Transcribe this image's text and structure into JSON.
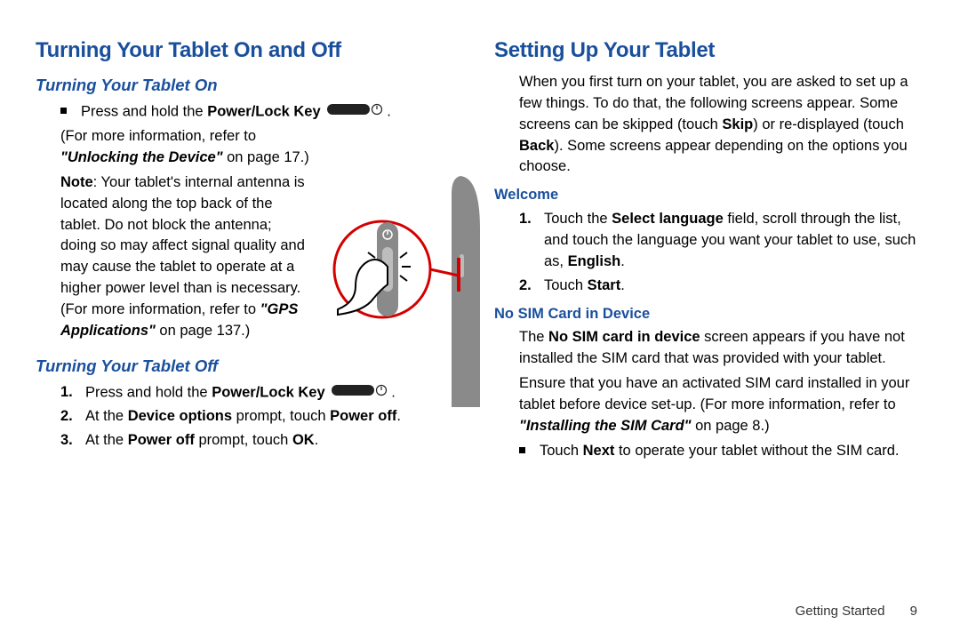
{
  "left": {
    "h1": "Turning Your Tablet On and Off",
    "sub_on": "Turning Your Tablet On",
    "on_bullet_a": "Press and hold the ",
    "on_bullet_b": "Power/Lock Key",
    "more1_a": "(For more information, refer to ",
    "more1_b": "\"Unlocking the Device\"",
    "more1_c": " on page 17.)",
    "note_a": "Note",
    "note_b": ": Your tablet's internal antenna is located along the top back of the tablet. Do not block the antenna; doing so may affect signal quality and may cause the tablet to operate at a higher power level than is necessary. (For more information, refer to ",
    "note_c": "\"GPS Applications\"",
    "note_d": " on page 137.)",
    "sub_off": "Turning Your Tablet Off",
    "off_1a": "Press and hold the ",
    "off_1b": "Power/Lock Key",
    "off_2a": "At the ",
    "off_2b": "Device options",
    "off_2c": " prompt, touch ",
    "off_2d": "Power off",
    "off_3a": "At the ",
    "off_3b": "Power off",
    "off_3c": " prompt, touch ",
    "off_3d": "OK",
    "n1": "1.",
    "n2": "2.",
    "n3": "3."
  },
  "right": {
    "h1": "Setting Up Your Tablet",
    "intro_a": "When you first turn on your tablet, you are asked to set up a few things. To do that, the following screens appear. Some screens can be skipped (touch ",
    "intro_b": "Skip",
    "intro_c": ") or re-displayed (touch ",
    "intro_d": "Back",
    "intro_e": "). Some screens appear depending on the options you choose.",
    "welcome_h": "Welcome",
    "w1a": "Touch the ",
    "w1b": "Select language",
    "w1c": " field, scroll through the list, and touch the language you want your tablet to use, such as, ",
    "w1d": "English",
    "w2a": "Touch ",
    "w2b": "Start",
    "nosim_h": "No SIM Card in Device",
    "ns1a": "The ",
    "ns1b": "No SIM card in device",
    "ns1c": " screen appears if you have not installed the SIM card that was provided with your tablet.",
    "ns2a": "Ensure that you have an activated SIM card installed in your tablet before device set-up. (For more information, refer to ",
    "ns2b": "\"Installing the SIM Card\"",
    "ns2c": " on page 8.)",
    "ns_bullet_a": "Touch ",
    "ns_bullet_b": "Next",
    "ns_bullet_c": " to operate your tablet without the SIM card.",
    "n1": "1.",
    "n2": "2."
  },
  "footer": {
    "section": "Getting Started",
    "page": "9"
  }
}
